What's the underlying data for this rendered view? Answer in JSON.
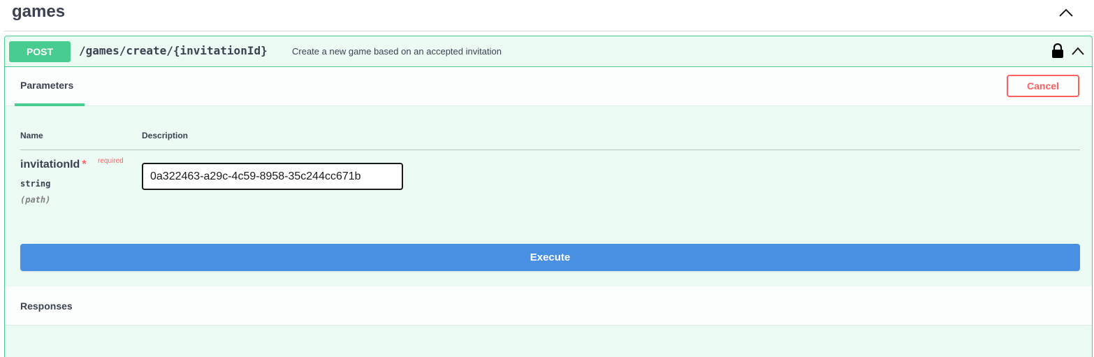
{
  "tag": {
    "title": "games",
    "chevron_icon": "chevron-up-icon"
  },
  "operation": {
    "method": "POST",
    "path": "/games/create/{invitationId}",
    "description": "Create a new game based on an accepted invitation",
    "lock_icon": "lock-icon",
    "chevron_icon": "chevron-up-icon",
    "color": "#49cc90"
  },
  "parameters": {
    "tab_label": "Parameters",
    "cancel_label": "Cancel",
    "columns": [
      "Name",
      "Description"
    ],
    "items": [
      {
        "name": "invitationId",
        "required_star": "*",
        "required_label": "required",
        "type": "string",
        "in": "(path)",
        "value": "0a322463-a29c-4c59-8958-35c244cc671b"
      }
    ]
  },
  "execute": {
    "label": "Execute",
    "color": "#4990e2"
  },
  "responses": {
    "title": "Responses"
  }
}
